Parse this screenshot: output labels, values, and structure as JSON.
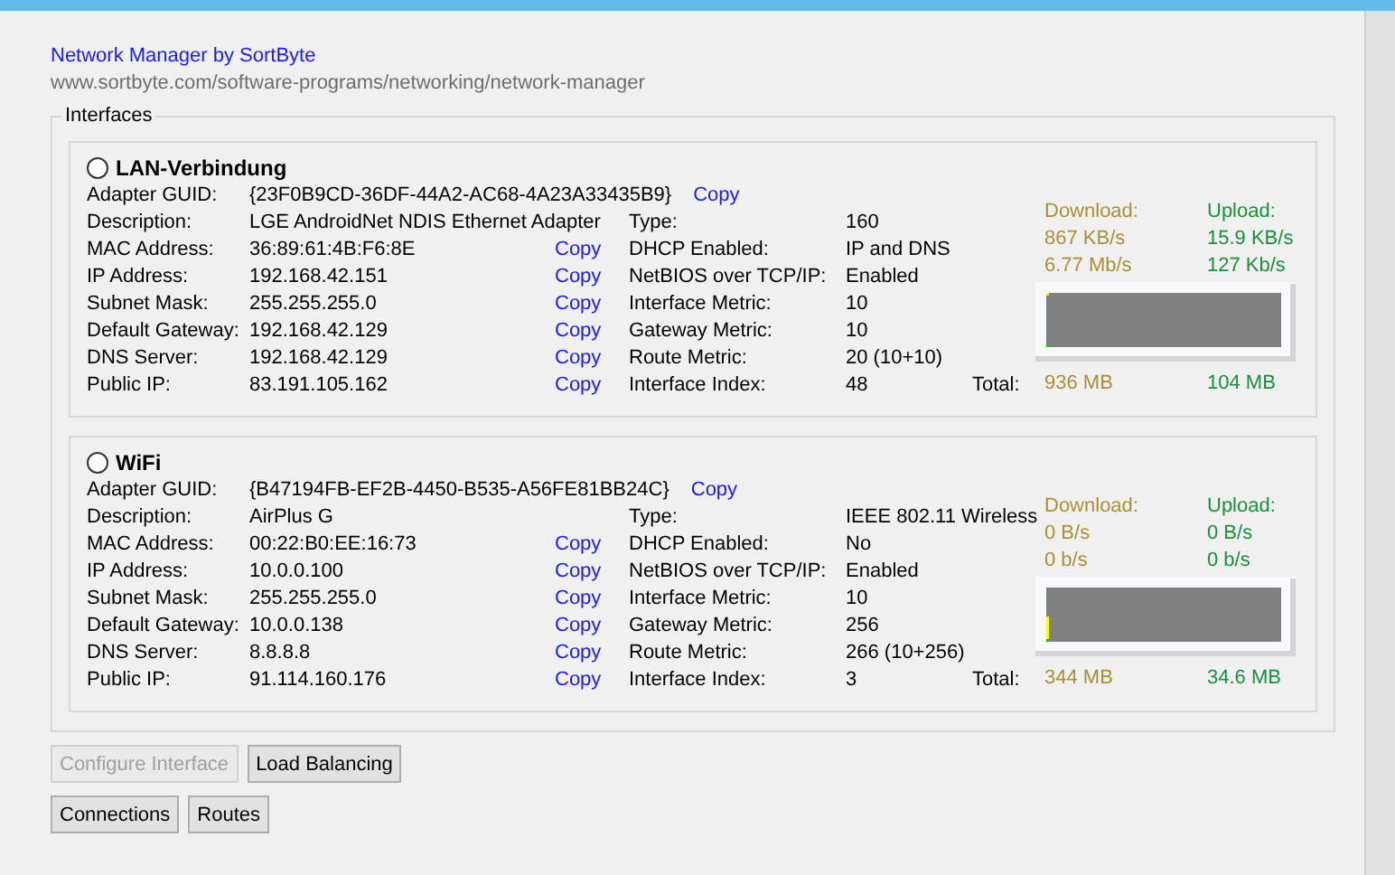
{
  "header": {
    "title": "Network Manager by SortByte",
    "url": "www.sortbyte.com/software-programs/networking/network-manager"
  },
  "group": {
    "title": "Interfaces"
  },
  "interfaces": [
    {
      "name": "LAN-Verbindung",
      "selected": false,
      "guid_label": "Adapter GUID:",
      "guid": "{23F0B9CD-36DF-44A2-AC68-4A23A33435B9}",
      "guid_copy": "Copy",
      "left": [
        {
          "label": "Description:",
          "value": "LGE AndroidNet NDIS Ethernet Adapter"
        },
        {
          "label": "MAC Address:",
          "value": "36:89:61:4B:F6:8E",
          "copy": "Copy"
        },
        {
          "label": "IP Address:",
          "value": "192.168.42.151",
          "copy": "Copy"
        },
        {
          "label": "Subnet Mask:",
          "value": "255.255.255.0",
          "copy": "Copy"
        },
        {
          "label": "Default Gateway:",
          "value": "192.168.42.129",
          "copy": "Copy"
        },
        {
          "label": "DNS Server:",
          "value": "192.168.42.129",
          "copy": "Copy"
        },
        {
          "label": "Public IP:",
          "value": "83.191.105.162",
          "copy": "Copy"
        }
      ],
      "right": [
        {
          "label": "Type:",
          "value": "160"
        },
        {
          "label": "DHCP Enabled:",
          "value": "IP and DNS"
        },
        {
          "label": "NetBIOS over TCP/IP:",
          "value": "Enabled"
        },
        {
          "label": "Interface Metric:",
          "value": "10"
        },
        {
          "label": "Gateway Metric:",
          "value": "10"
        },
        {
          "label": "Route Metric:",
          "value": "20 (10+10)"
        },
        {
          "label": "Interface Index:",
          "value": "48"
        }
      ],
      "download": {
        "label": "Download:",
        "bytes": "867 KB/s",
        "bits": "6.77 Mb/s",
        "total": "936 MB"
      },
      "upload": {
        "label": "Upload:",
        "bytes": "15.9 KB/s",
        "bits": "127 Kb/s",
        "total": "104 MB"
      },
      "total_label": "Total:"
    },
    {
      "name": "WiFi",
      "selected": false,
      "guid_label": "Adapter GUID:",
      "guid": "{B47194FB-EF2B-4450-B535-A56FE81BB24C}",
      "guid_copy": "Copy",
      "left": [
        {
          "label": "Description:",
          "value": "AirPlus G"
        },
        {
          "label": "MAC Address:",
          "value": "00:22:B0:EE:16:73",
          "copy": "Copy"
        },
        {
          "label": "IP Address:",
          "value": "10.0.0.100",
          "copy": "Copy"
        },
        {
          "label": "Subnet Mask:",
          "value": "255.255.255.0",
          "copy": "Copy"
        },
        {
          "label": "Default Gateway:",
          "value": "10.0.0.138",
          "copy": "Copy"
        },
        {
          "label": "DNS Server:",
          "value": "8.8.8.8",
          "copy": "Copy"
        },
        {
          "label": "Public IP:",
          "value": "91.114.160.176",
          "copy": "Copy"
        }
      ],
      "right": [
        {
          "label": "Type:",
          "value": "IEEE 802.11 Wireless"
        },
        {
          "label": "DHCP Enabled:",
          "value": "No"
        },
        {
          "label": "NetBIOS over TCP/IP:",
          "value": "Enabled"
        },
        {
          "label": "Interface Metric:",
          "value": "10"
        },
        {
          "label": "Gateway Metric:",
          "value": "256"
        },
        {
          "label": "Route Metric:",
          "value": "266 (10+256)"
        },
        {
          "label": "Interface Index:",
          "value": "3"
        }
      ],
      "download": {
        "label": "Download:",
        "bytes": "0 B/s",
        "bits": "0 b/s",
        "total": "344 MB"
      },
      "upload": {
        "label": "Upload:",
        "bytes": "0 B/s",
        "bits": "0 b/s",
        "total": "34.6 MB"
      },
      "total_label": "Total:"
    }
  ],
  "buttons": [
    {
      "label": "Configure Interface",
      "disabled": true
    },
    {
      "label": "Load Balancing",
      "disabled": false
    },
    {
      "label": "Connections",
      "disabled": false
    },
    {
      "label": "Routes",
      "disabled": false
    }
  ]
}
